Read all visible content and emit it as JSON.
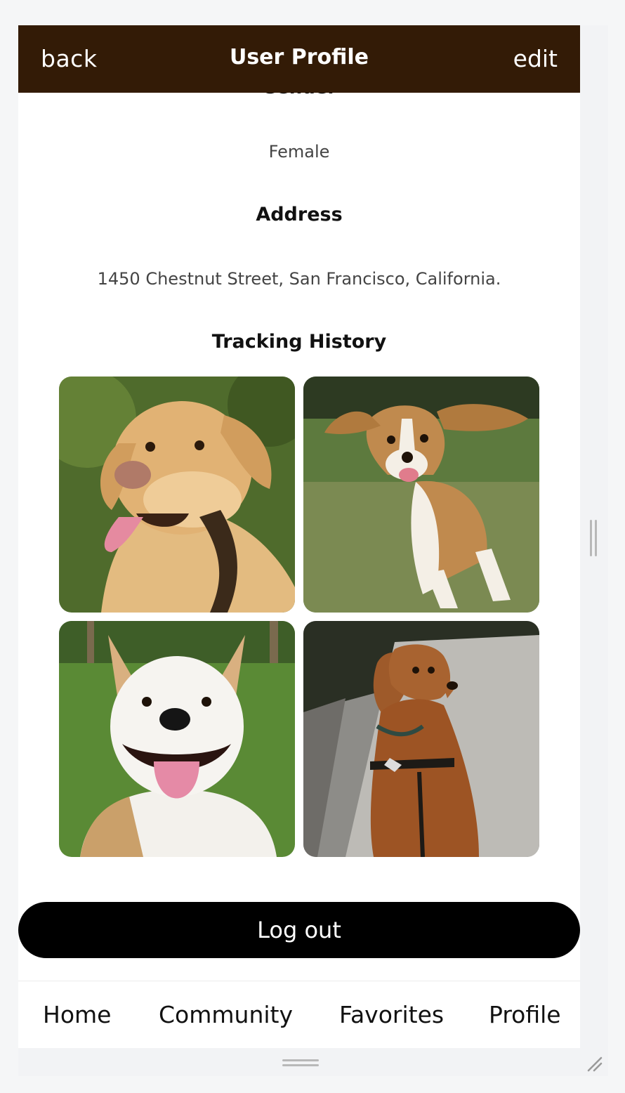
{
  "header": {
    "back_label": "back",
    "title": "User Profile",
    "edit_label": "edit",
    "background": "#331b06"
  },
  "profile": {
    "gender_label": "Gender",
    "gender_value": "Female",
    "address_label": "Address",
    "address_value": "1450 Chestnut Street, San Francisco, California.",
    "tracking_label": "Tracking History"
  },
  "tracking_images": [
    {
      "icon": "golden-labrador-photo"
    },
    {
      "icon": "running-beagle-photo"
    },
    {
      "icon": "smiling-white-terrier-photo"
    },
    {
      "icon": "golden-retriever-sitting-photo"
    }
  ],
  "logout_label": "Log out",
  "tabs": [
    {
      "label": "Home"
    },
    {
      "label": "Community"
    },
    {
      "label": "Favorites"
    },
    {
      "label": "Profile"
    }
  ]
}
